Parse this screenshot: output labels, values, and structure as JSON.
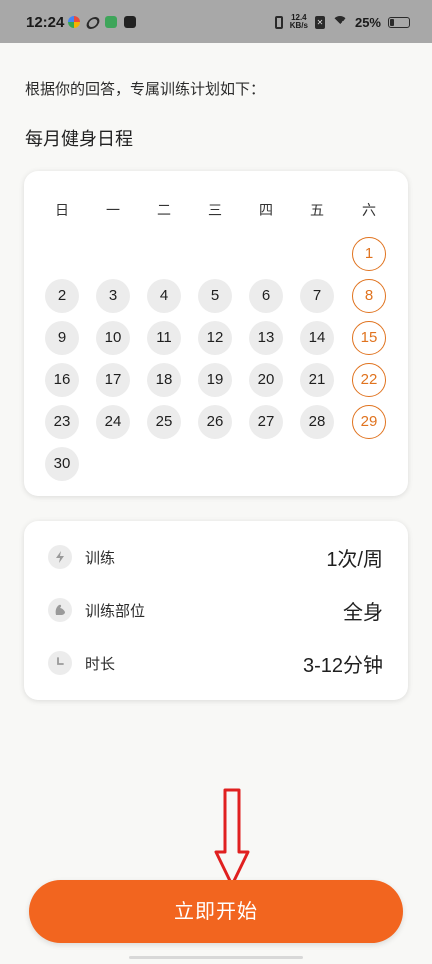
{
  "status_bar": {
    "time": "12:24",
    "net_speed_value": "12.4",
    "net_speed_unit": "KB/s",
    "battery_percent": "25%",
    "battery_level": 0.25,
    "icons": [
      "weather-icon",
      "sync-icon",
      "app-icon",
      "message-icon",
      "vibrate-icon",
      "no-sim-icon",
      "wifi-icon",
      "battery-icon"
    ]
  },
  "intro_text": "根据你的回答，专属训练计划如下：",
  "schedule_title": "每月健身日程",
  "calendar": {
    "weekdays": [
      "日",
      "一",
      "二",
      "三",
      "四",
      "五",
      "六"
    ],
    "first_weekday_index": 6,
    "days_in_month": 30,
    "training_days": [
      1,
      8,
      15,
      22,
      29
    ],
    "highlight_color": "#e0731f"
  },
  "summary": [
    {
      "icon": "lightning-icon",
      "label": "训练",
      "value": "1次/周"
    },
    {
      "icon": "muscle-icon",
      "label": "训练部位",
      "value": "全身"
    },
    {
      "icon": "clock-icon",
      "label": "时长",
      "value": "3-12分钟"
    }
  ],
  "annotation_arrow_color": "#e02020",
  "start_button": {
    "label": "立即开始",
    "color": "#f2651f"
  }
}
